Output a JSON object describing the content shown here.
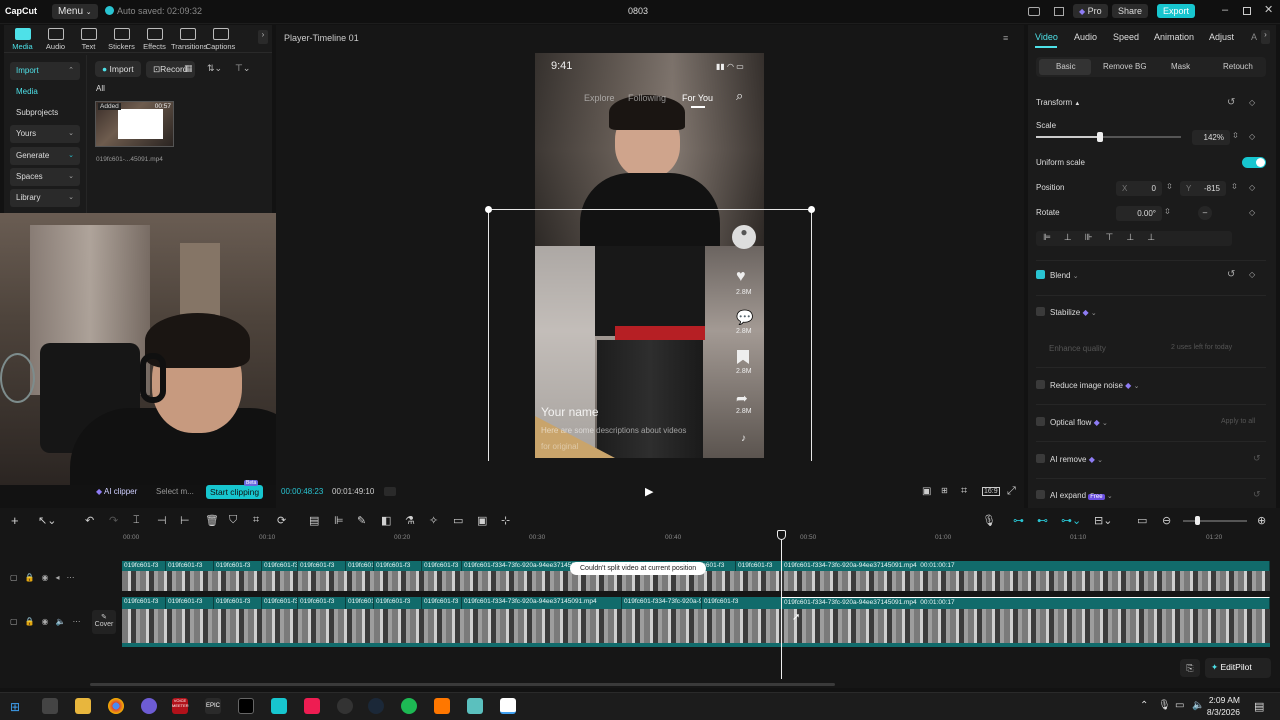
{
  "app": {
    "logo": "CapCut",
    "menu": "Menu",
    "autosave": "Auto saved: 02:09:32",
    "project_title": "0803",
    "pro": "Pro",
    "share": "Share",
    "export": "Export"
  },
  "left_tabs": [
    {
      "label": "Media",
      "icon": "media-icon"
    },
    {
      "label": "Audio",
      "icon": "audio-icon"
    },
    {
      "label": "Text",
      "icon": "text-icon"
    },
    {
      "label": "Stickers",
      "icon": "stickers-icon"
    },
    {
      "label": "Effects",
      "icon": "effects-icon"
    },
    {
      "label": "Transitions",
      "icon": "transitions-icon"
    },
    {
      "label": "Captions",
      "icon": "captions-icon"
    }
  ],
  "left_nav": [
    "Import",
    "Media",
    "Subprojects",
    "Yours",
    "Generate",
    "Spaces",
    "Library"
  ],
  "media": {
    "import": "Import",
    "record": "Record",
    "filter_all": "All",
    "thumb_badge": "Added",
    "thumb_duration": "00:57",
    "thumb_name": "019fc601-...45091.mp4"
  },
  "player": {
    "title": "Player-Timeline 01",
    "status_time": "9:41",
    "feed_tabs": [
      "Explore",
      "Following",
      "For You"
    ],
    "side_counts": [
      "2.8M",
      "2.8M",
      "2.8M",
      "2.8M"
    ],
    "name": "Your name",
    "desc1": "Here are some descriptions about videos",
    "desc2": "for original",
    "current_time": "00:00:48:23",
    "total_time": "00:01:49:10"
  },
  "ai_bar": {
    "ai_clipper": "AI clipper",
    "select": "Select m...",
    "start_clipping": "Start clipping",
    "beta": "Beta"
  },
  "inspector": {
    "tabs": [
      "Video",
      "Audio",
      "Speed",
      "Animation",
      "Adjust",
      "A"
    ],
    "subtabs": [
      "Basic",
      "Remove BG",
      "Mask",
      "Retouch"
    ],
    "transform": "Transform",
    "scale_label": "Scale",
    "scale_value": "142%",
    "scale_fraction": 0.44,
    "uniform_scale": "Uniform scale",
    "position_label": "Position",
    "pos_x_label": "X",
    "pos_x": "0",
    "pos_y_label": "Y",
    "pos_y": "-815",
    "rotate_label": "Rotate",
    "rotate_value": "0.00°",
    "rotate_dash": "–",
    "blend": "Blend",
    "stabilize": "Stabilize",
    "enhance_quality": "Enhance quality",
    "uses_left": "2 uses left for today",
    "reduce_noise": "Reduce image noise",
    "optical_flow": "Optical flow",
    "apply_all": "Apply to all",
    "ai_remove": "AI remove",
    "ai_expand": "AI expand",
    "free": "Free"
  },
  "timeline": {
    "ruler": [
      "00:00",
      "00:10",
      "00:20",
      "00:30",
      "00:40",
      "00:50",
      "01:00",
      "01:10",
      "01:20"
    ],
    "clip_label_short": "019fc601-f3",
    "clip_label_long": "019fc601-f334-73fc-920a-94ee37145091.mp4",
    "clip_time": "00:01:00:17",
    "toast": "Couldn't split video at current position",
    "cover": "Cover",
    "editpilot": "EditPilot"
  },
  "taskbar": {
    "time": "2:09 AM",
    "date": "8/3/2026",
    "epic": "EPIC",
    "voice": "VOICE MEETER"
  }
}
